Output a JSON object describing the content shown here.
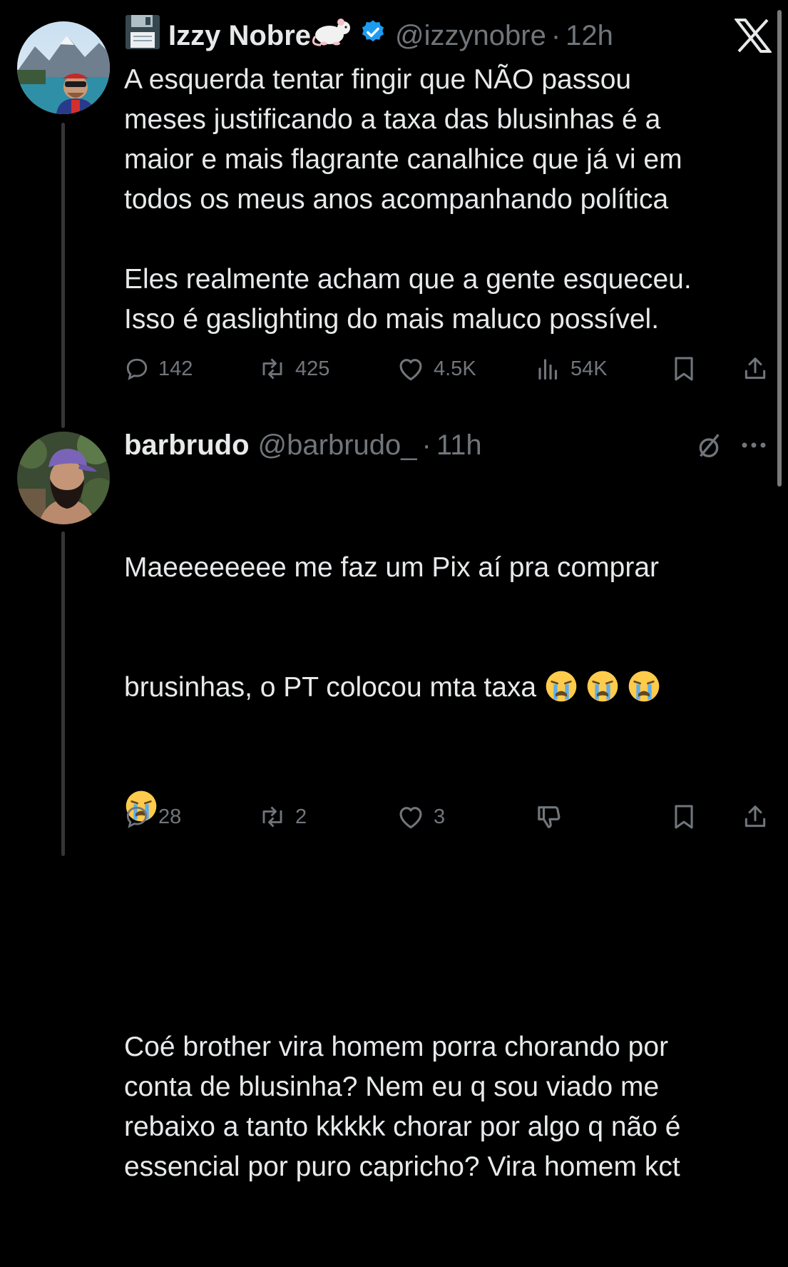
{
  "tweets": [
    {
      "display_name": "Izzy Nobre",
      "name_emojis": "💾 🐁",
      "handle": "@izzynobre",
      "separator": "·",
      "time": "12h",
      "text": "A esquerda tentar fingir que NÃO passou\nmeses justificando a taxa das blusinhas é a\nmaior e mais flagrante canalhice que já vi em\ntodos os meus anos acompanhando política\n\nEles realmente acham que a gente esqueceu.\nIsso é gaslighting do mais maluco possível.",
      "stats": {
        "replies": "142",
        "reposts": "425",
        "likes": "4.5K",
        "views": "54K"
      }
    },
    {
      "display_name": "barbrudo",
      "handle": "@barbrudo_",
      "separator": "·",
      "time": "11h",
      "text_line1": "Maeeeeeeee me faz um Pix aí pra comprar",
      "text_line2": "brusinhas, o PT colocou mta taxa",
      "text_emoji": "😭 😭 😭 😭",
      "text_rest": "Coé brother vira homem porra chorando por\nconta de blusinha? Nem eu q sou viado me\nrebaixo a tanto kkkkk chorar por algo q não é\nessencial por puro capricho? Vira homem kct",
      "stats": {
        "replies": "28",
        "reposts": "2",
        "likes": "3"
      }
    }
  ],
  "icons": {
    "verified": "verified-badge-icon",
    "app_logo": "x-logo-icon",
    "more": "more-icon",
    "grok": "grok-icon",
    "reply": "reply-icon",
    "repost": "repost-icon",
    "like": "like-icon",
    "views": "views-icon",
    "bookmark": "bookmark-icon",
    "share": "share-icon",
    "dislike": "dislike-icon"
  },
  "colors": {
    "background": "#000000",
    "text": "#e7e9ea",
    "muted": "#71767b",
    "verified": "#1d9bf0"
  }
}
